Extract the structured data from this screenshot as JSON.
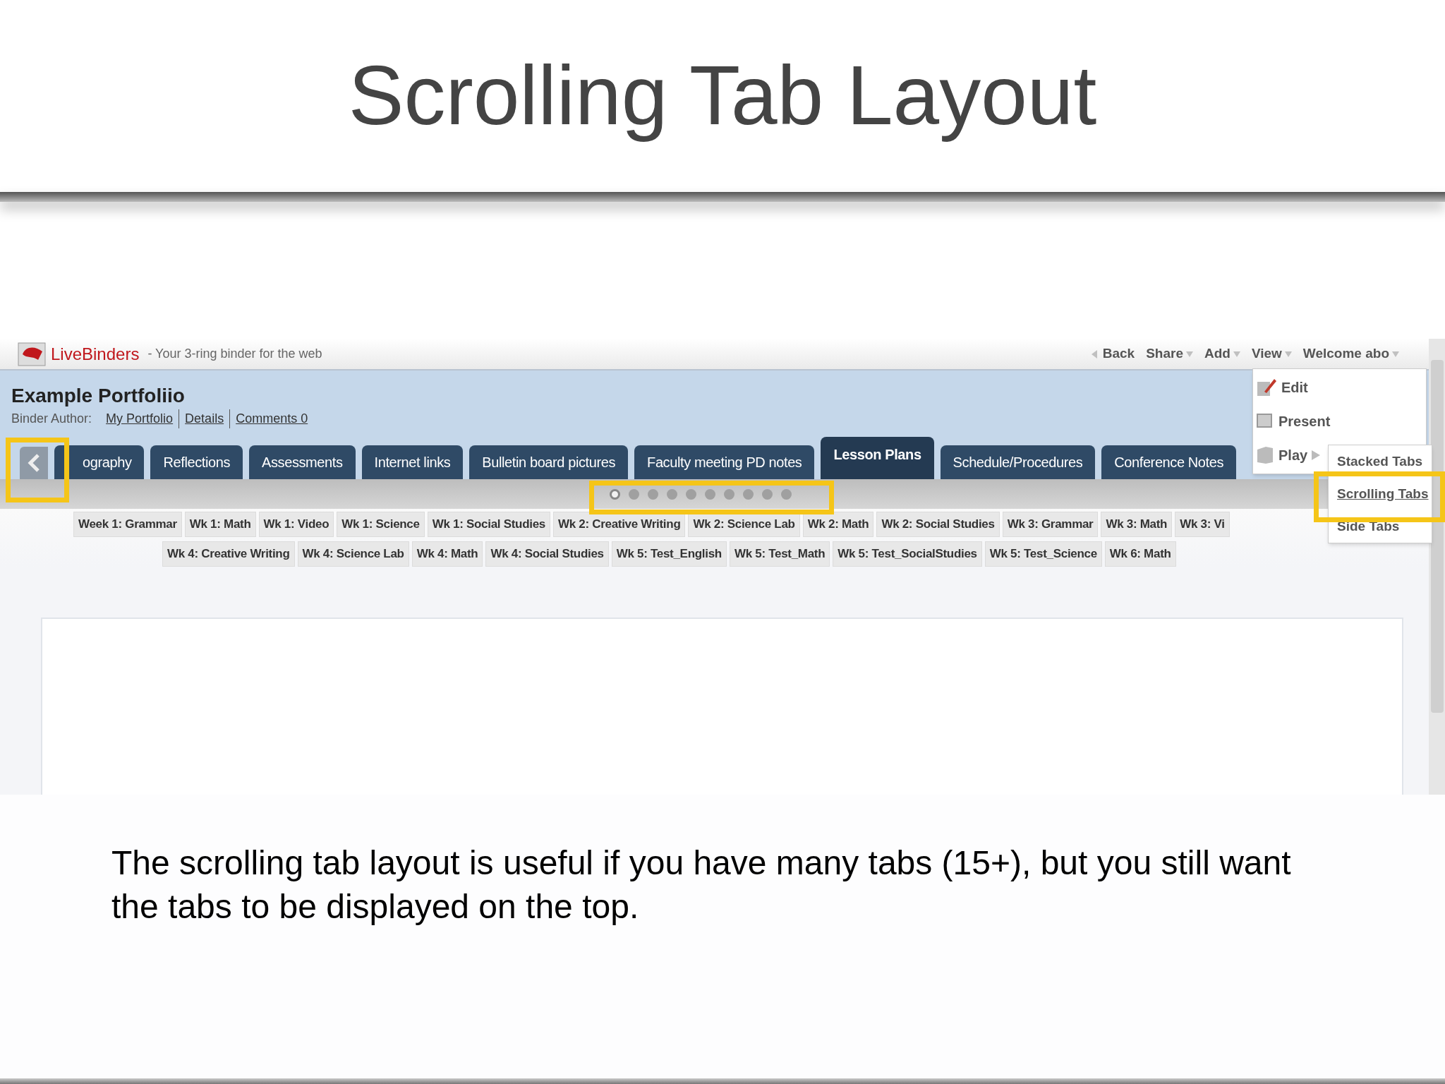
{
  "slide": {
    "title": "Scrolling Tab Layout",
    "caption": "The scrolling tab layout is useful if you have many tabs (15+), but you still want the tabs to be displayed on the top."
  },
  "app": {
    "logo": "LiveBinders",
    "tagline": "- Your 3-ring binder for the web",
    "nav": [
      {
        "label": "Back",
        "kind": "back"
      },
      {
        "label": "Share",
        "kind": "menu"
      },
      {
        "label": "Add",
        "kind": "menu"
      },
      {
        "label": "View",
        "kind": "menu"
      },
      {
        "label": "Welcome abo",
        "kind": "menu"
      }
    ],
    "binder_title": "Example Portfoliio",
    "author_label": "Binder Author:",
    "links": [
      "My Portfolio",
      "Details",
      "Comments 0"
    ],
    "tabs": [
      {
        "label": "ography",
        "selected": false
      },
      {
        "label": "Reflections",
        "selected": false
      },
      {
        "label": "Assessments",
        "selected": false
      },
      {
        "label": "Internet links",
        "selected": false
      },
      {
        "label": "Bulletin board pictures",
        "selected": false
      },
      {
        "label": "Faculty meeting PD notes",
        "selected": false
      },
      {
        "label": "Lesson Plans",
        "selected": true
      },
      {
        "label": "Schedule/Procedures",
        "selected": false
      },
      {
        "label": "Conference Notes",
        "selected": false
      }
    ],
    "pager": [
      {
        "selected": true
      },
      {
        "selected": false
      },
      {
        "selected": false
      },
      {
        "selected": false
      },
      {
        "selected": false
      },
      {
        "selected": false
      },
      {
        "selected": false
      },
      {
        "selected": false
      },
      {
        "selected": false
      },
      {
        "selected": false
      }
    ],
    "subtab_rows": [
      [
        "Week 1: Grammar",
        "Wk 1: Math",
        "Wk 1: Video",
        "Wk 1: Science",
        "Wk 1: Social Studies",
        "Wk 2: Creative Writing",
        "Wk 2: Science Lab",
        "Wk 2: Math",
        "Wk 2: Social Studies",
        "Wk 3: Grammar",
        "Wk 3: Math",
        "Wk 3: Vi"
      ],
      [
        "Wk 4: Creative Writing",
        "Wk 4: Science Lab",
        "Wk 4: Math",
        "Wk 4: Social Studies",
        "Wk 5: Test_English",
        "Wk 5: Test_Math",
        "Wk 5: Test_SocialStudies",
        "Wk 5: Test_Science",
        "Wk 6: Math"
      ]
    ],
    "view_menu": [
      {
        "label": "Edit",
        "kind": "edit"
      },
      {
        "label": "Present",
        "kind": "present"
      },
      {
        "label": "Play",
        "kind": "submenu"
      }
    ],
    "layout_menu": [
      {
        "label": "Stacked Tabs",
        "selected": false
      },
      {
        "label": "Scrolling Tabs",
        "selected": true
      },
      {
        "label": "Side Tabs",
        "selected": false
      }
    ]
  }
}
